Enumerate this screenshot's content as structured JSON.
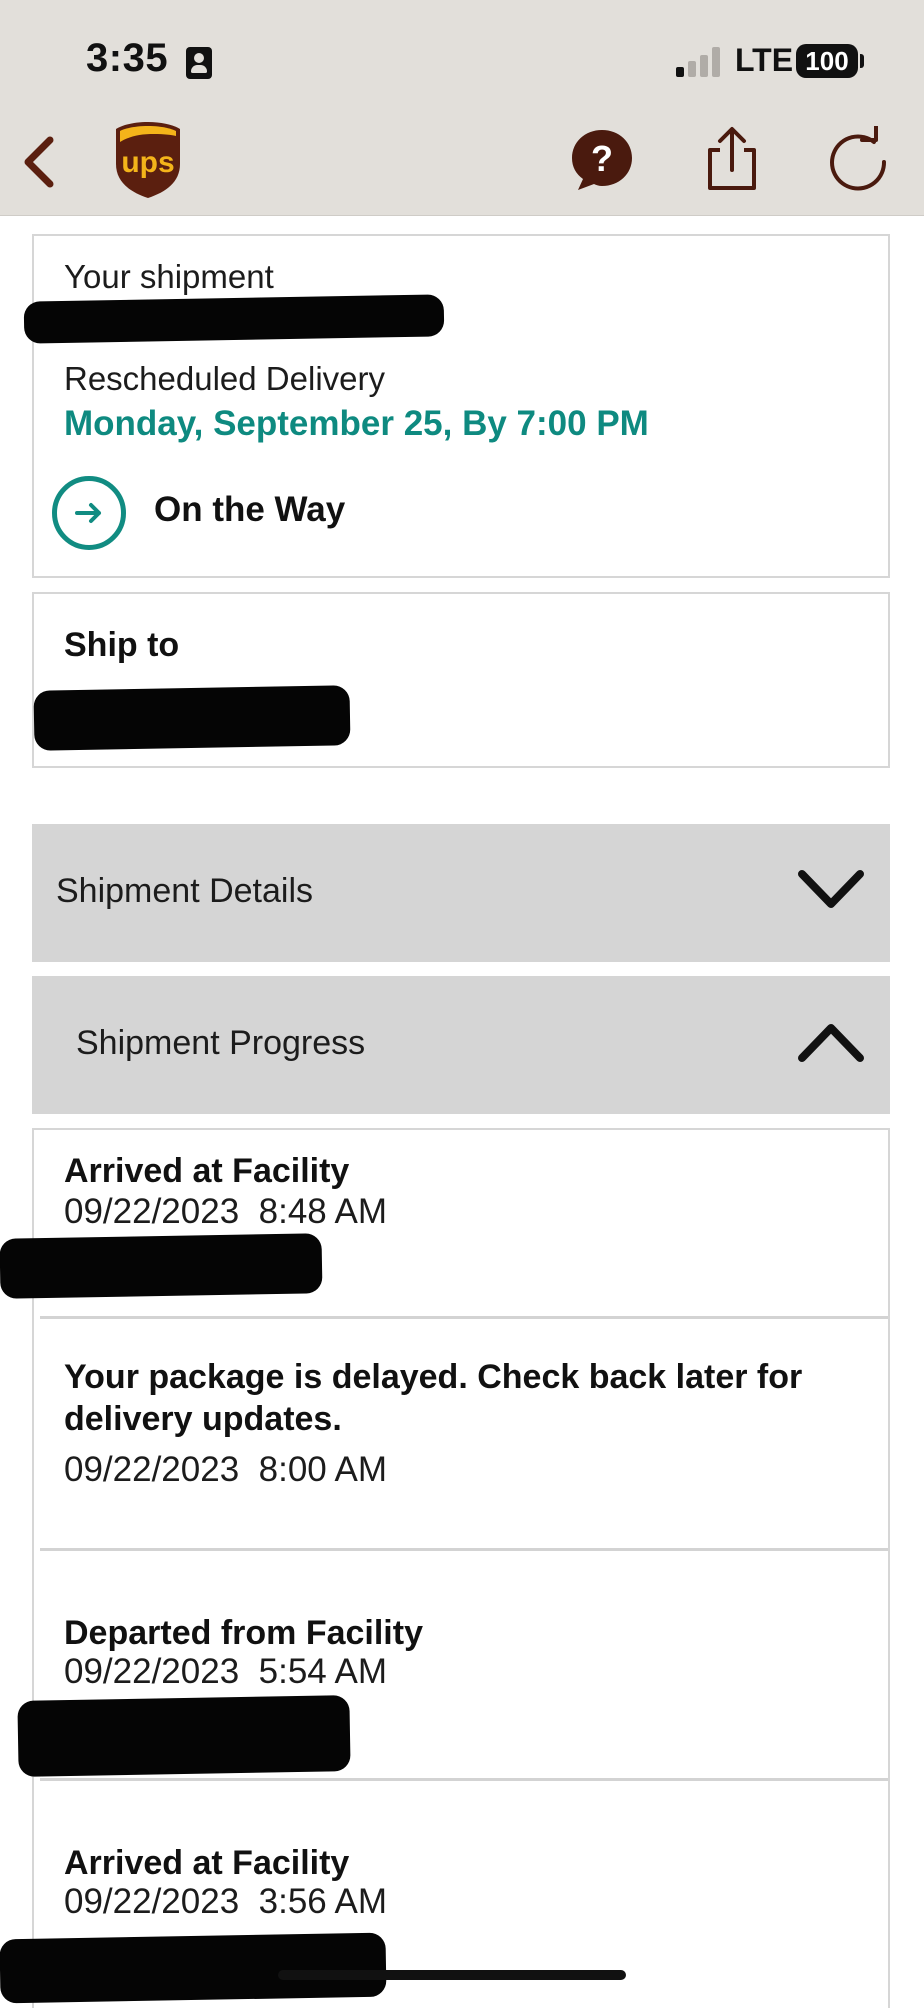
{
  "status_bar": {
    "time": "3:35",
    "network": "LTE",
    "battery": "100"
  },
  "nav": {
    "back_icon": "chevron-left-icon",
    "logo": "ups",
    "help_icon": "help-bubble-icon",
    "share_icon": "share-icon",
    "refresh_icon": "refresh-icon",
    "brand_color": "#5b1f0f",
    "logo_gold": "#f4b41a"
  },
  "shipment": {
    "title": "Your shipment",
    "status_label": "Rescheduled Delivery",
    "delivery_date": "Monday, September 25, By 7:00 PM",
    "status": "On the Way",
    "accent_color": "#0e8a80"
  },
  "ship_to": {
    "title": "Ship to"
  },
  "sections": {
    "details_label": "Shipment Details",
    "progress_label": "Shipment Progress"
  },
  "progress_events": [
    {
      "title": "Arrived at Facility",
      "date": "09/22/2023",
      "time": "8:48 AM"
    },
    {
      "title": "Your package is delayed. Check back later for delivery updates.",
      "date": "09/22/2023",
      "time": "8:00 AM"
    },
    {
      "title": "Departed from Facility",
      "date": "09/22/2023",
      "time": "5:54 AM"
    },
    {
      "title": "Arrived at Facility",
      "date": "09/22/2023",
      "time": "3:56 AM"
    }
  ]
}
